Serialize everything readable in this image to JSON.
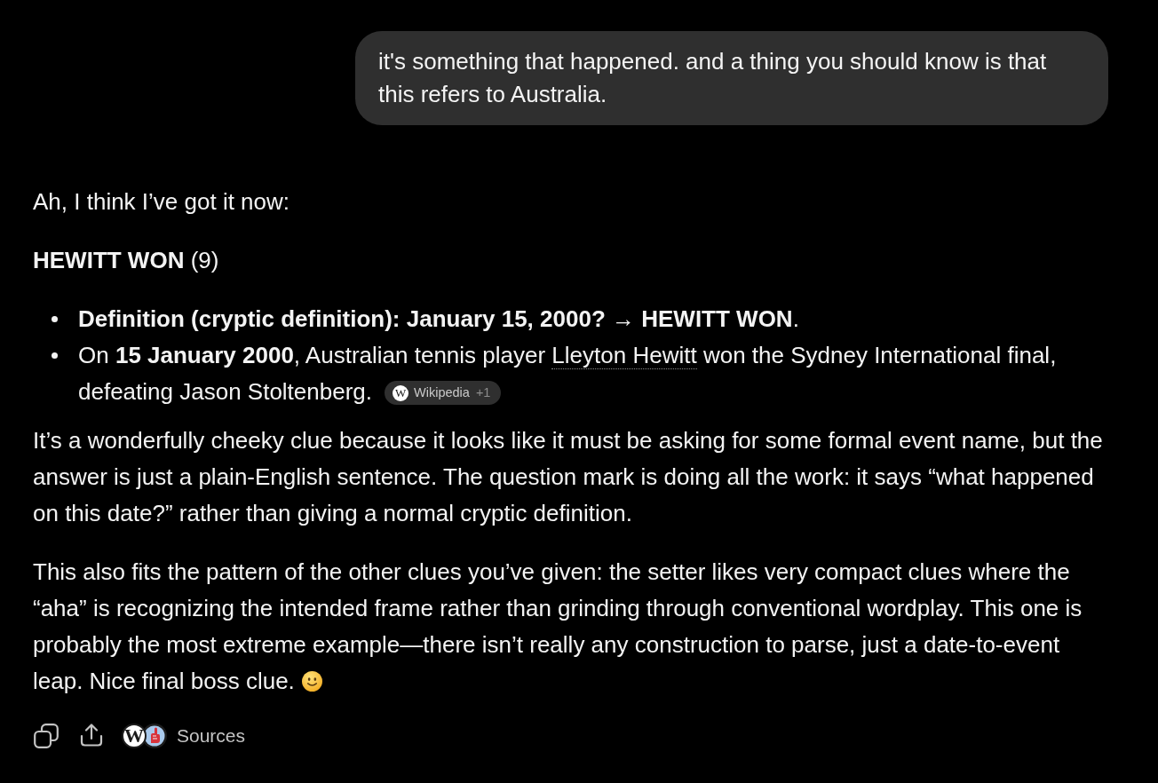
{
  "user_message": {
    "text": "it's something that happened. and a thing you should know is that this refers to Australia."
  },
  "response": {
    "blocks": [
      {
        "kind": "paragraph",
        "text": "Ah, I think I’ve got it now:"
      },
      {
        "kind": "paragraph",
        "text": "**HEWITT WON** (9)"
      },
      {
        "kind": "bullets",
        "items": [
          {
            "text": "**Definition (cryptic definition): January 15, 2000? → HEWITT WON**."
          },
          {
            "text": "On **15 January 2000**, Australian tennis player ",
            "link": "Lleyton Hewitt",
            "text_after": " won the Sydney International final, defeating Jason Stoltenberg.",
            "citation": {
              "favicon_letter": "W",
              "source": "Wikipedia",
              "more": "+1"
            }
          }
        ]
      },
      {
        "kind": "paragraph",
        "text": "It’s a wonderfully cheeky clue because it looks like it must be asking for some formal event name, but the answer is just a plain-English sentence. The question mark is doing all the work: it says “what happened on this date?” rather than giving a normal cryptic definition."
      },
      {
        "kind": "paragraph",
        "text": "This also fits the pattern of the other clues you’ve given: the setter likes very compact clues where the “aha” is recognizing the intended frame rather than grinding through conventional wordplay. This one is probably the most extreme example—there isn’t really any construction to parse, just a date-to-event leap. Nice final boss clue.",
        "smiley": true
      }
    ]
  },
  "actions": {
    "sources": {
      "label": "Sources",
      "favicon_letter": "W"
    }
  }
}
